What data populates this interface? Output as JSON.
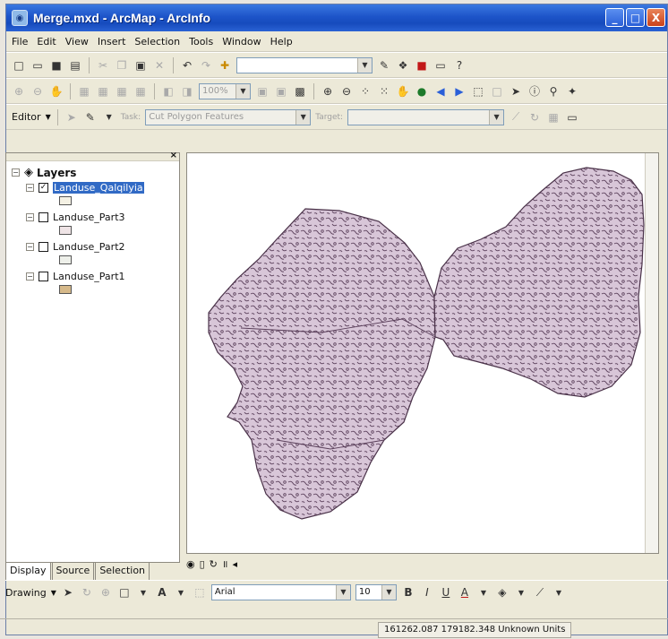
{
  "window": {
    "title": "Merge.mxd - ArcMap - ArcInfo",
    "min": "_",
    "max": "□",
    "close": "X"
  },
  "menu": [
    "File",
    "Edit",
    "View",
    "Insert",
    "Selection",
    "Tools",
    "Window",
    "Help"
  ],
  "toolbar3": {
    "zoom_value": "100%"
  },
  "editor": {
    "label": "Editor",
    "task_label": "Task:",
    "task_value": "Cut Polygon Features",
    "target_label": "Target:"
  },
  "toc": {
    "root": "Layers",
    "layers": [
      {
        "name": "Landuse_Qalqilyia",
        "checked": true,
        "selected": true,
        "swatch": "#f4f1e4"
      },
      {
        "name": "Landuse_Part3",
        "checked": false,
        "selected": false,
        "swatch": "#efe4e6"
      },
      {
        "name": "Landuse_Part2",
        "checked": false,
        "selected": false,
        "swatch": "#eef0ea"
      },
      {
        "name": "Landuse_Part1",
        "checked": false,
        "selected": false,
        "swatch": "#d6b98a"
      }
    ],
    "tabs": [
      "Display",
      "Source",
      "Selection"
    ]
  },
  "map": {
    "fill": "#d6c4d6",
    "outline": "#5a3f5a"
  },
  "drawing": {
    "label": "Drawing",
    "font": "Arial",
    "size": "10"
  },
  "status": {
    "coords": "161262.087  179182.348 Unknown Units"
  }
}
